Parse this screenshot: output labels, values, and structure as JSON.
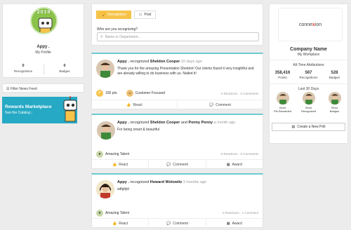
{
  "profile": {
    "badge_year": "2019",
    "name": "Appy .",
    "subtitle": "My Profile",
    "stats": [
      {
        "value": "0",
        "label": "Recognitions"
      },
      {
        "value": "0",
        "label": "Badges"
      }
    ]
  },
  "filter": {
    "label": "Filter News Feed"
  },
  "rewards": {
    "title": "Rewards Marketplace",
    "link": "See the Catalog ›"
  },
  "recognize": {
    "tabs": [
      {
        "label": "Recognition",
        "icon": "trophy-icon",
        "active": true
      },
      {
        "label": "Post",
        "icon": "document-icon",
        "active": false
      }
    ],
    "question": "Who are you recognizing?",
    "placeholder": "Name or Department..."
  },
  "posts": [
    {
      "author": "Appy .",
      "verb": "recognized",
      "recipient": "Sheldon Cooper",
      "connector": "",
      "recipient2": "",
      "time": "10 days ago",
      "body": "Thank you for the amazing Presentation Sheldon! Our clients found it very insightful and are already willing to do business with us. Nailed it!",
      "points": "100 pts.",
      "badge": "Customer Focused",
      "counts": "0 Reactions  ·  0 Comments",
      "actions": [
        "React",
        "Comment"
      ]
    },
    {
      "author": "Appy .",
      "verb": "recognized",
      "recipient": "Sheldon Cooper",
      "connector": "and",
      "recipient2": "Penny Penny",
      "time": "a month ago",
      "body": "For being smart & beautiful",
      "badge": "Amazing Talent",
      "counts": "0 Reactions  ·  0 Comments",
      "actions": [
        "React",
        "Comment",
        "Award"
      ]
    },
    {
      "author": "Appy .",
      "verb": "recognized",
      "recipient": "Howard Wolowitz",
      "time": "3 months ago",
      "body": "sdfghjkl",
      "badge": "Amazing Talent",
      "counts": "0 Reactions  ·  1 Comment",
      "actions": [
        "React",
        "Comment",
        "Award"
      ]
    }
  ],
  "company": {
    "logo": {
      "pre": "conne",
      "x": "x",
      "post": "ion"
    },
    "name": "Company Name",
    "subtitle": "My Workplace",
    "all_time_label": "All-Time Attributions",
    "all_time": [
      {
        "value": "358,416",
        "label": "Points"
      },
      {
        "value": "567",
        "label": "Recognitions"
      },
      {
        "value": "528",
        "label": "Badges"
      }
    ],
    "last30_label": "Last 30 Days",
    "last30": [
      {
        "label1": "Most",
        "label2": "Pts Rewarded"
      },
      {
        "label1": "Most",
        "label2": "Recognized"
      },
      {
        "label1": "Most",
        "label2": "Badges"
      }
    ]
  },
  "poll": {
    "label": "Create a New Poll"
  },
  "colors": {
    "accent": "#f6c34a",
    "teal": "#6ccad0",
    "rewards": "#26a9c4"
  }
}
